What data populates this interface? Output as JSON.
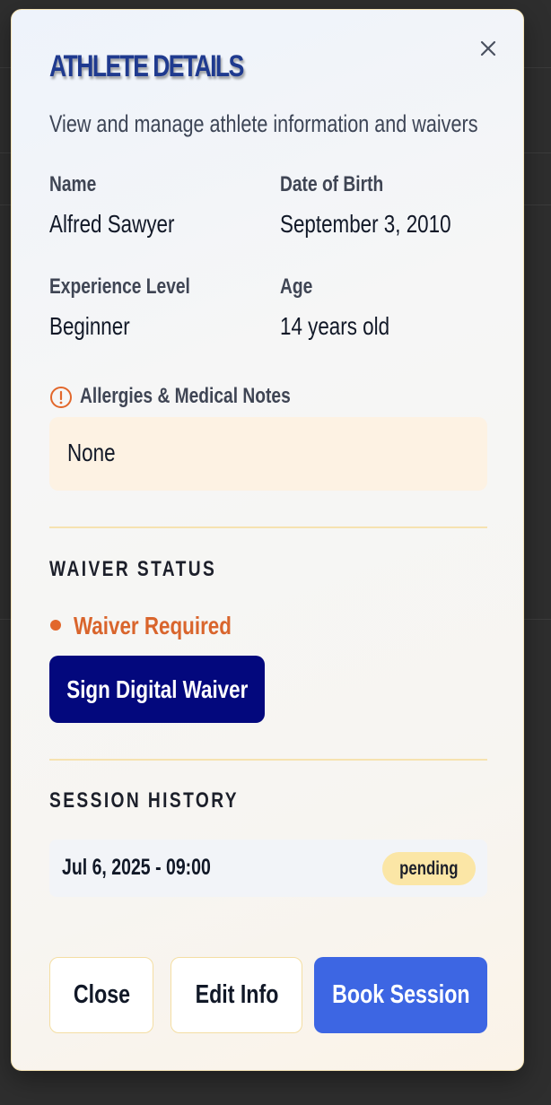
{
  "modal": {
    "title": "Athlete Details",
    "subtitle": "View and manage athlete information and waivers"
  },
  "athlete": {
    "name_label": "Name",
    "name": "Alfred Sawyer",
    "dob_label": "Date of Birth",
    "dob": "September 3, 2010",
    "experience_label": "Experience Level",
    "experience": "Beginner",
    "age_label": "Age",
    "age": "14 years old"
  },
  "medical": {
    "icon": "alert-circle-icon",
    "label": "Allergies & Medical Notes",
    "value": "None"
  },
  "waiver": {
    "heading": "Waiver Status",
    "status": "Waiver Required",
    "sign_button": "Sign Digital Waiver"
  },
  "sessions": {
    "heading": "Session History",
    "items": [
      {
        "datetime": "Jul 6, 2025 - 09:00",
        "status": "pending"
      }
    ]
  },
  "actions": {
    "close": "Close",
    "edit": "Edit Info",
    "book": "Book Session"
  },
  "colors": {
    "title": "#1f3a8f",
    "warning": "#d9652c",
    "primary_dark": "#03087d",
    "primary": "#3d66e3",
    "badge_pending": "#fbe6a6",
    "divider": "#f6e2b0"
  }
}
